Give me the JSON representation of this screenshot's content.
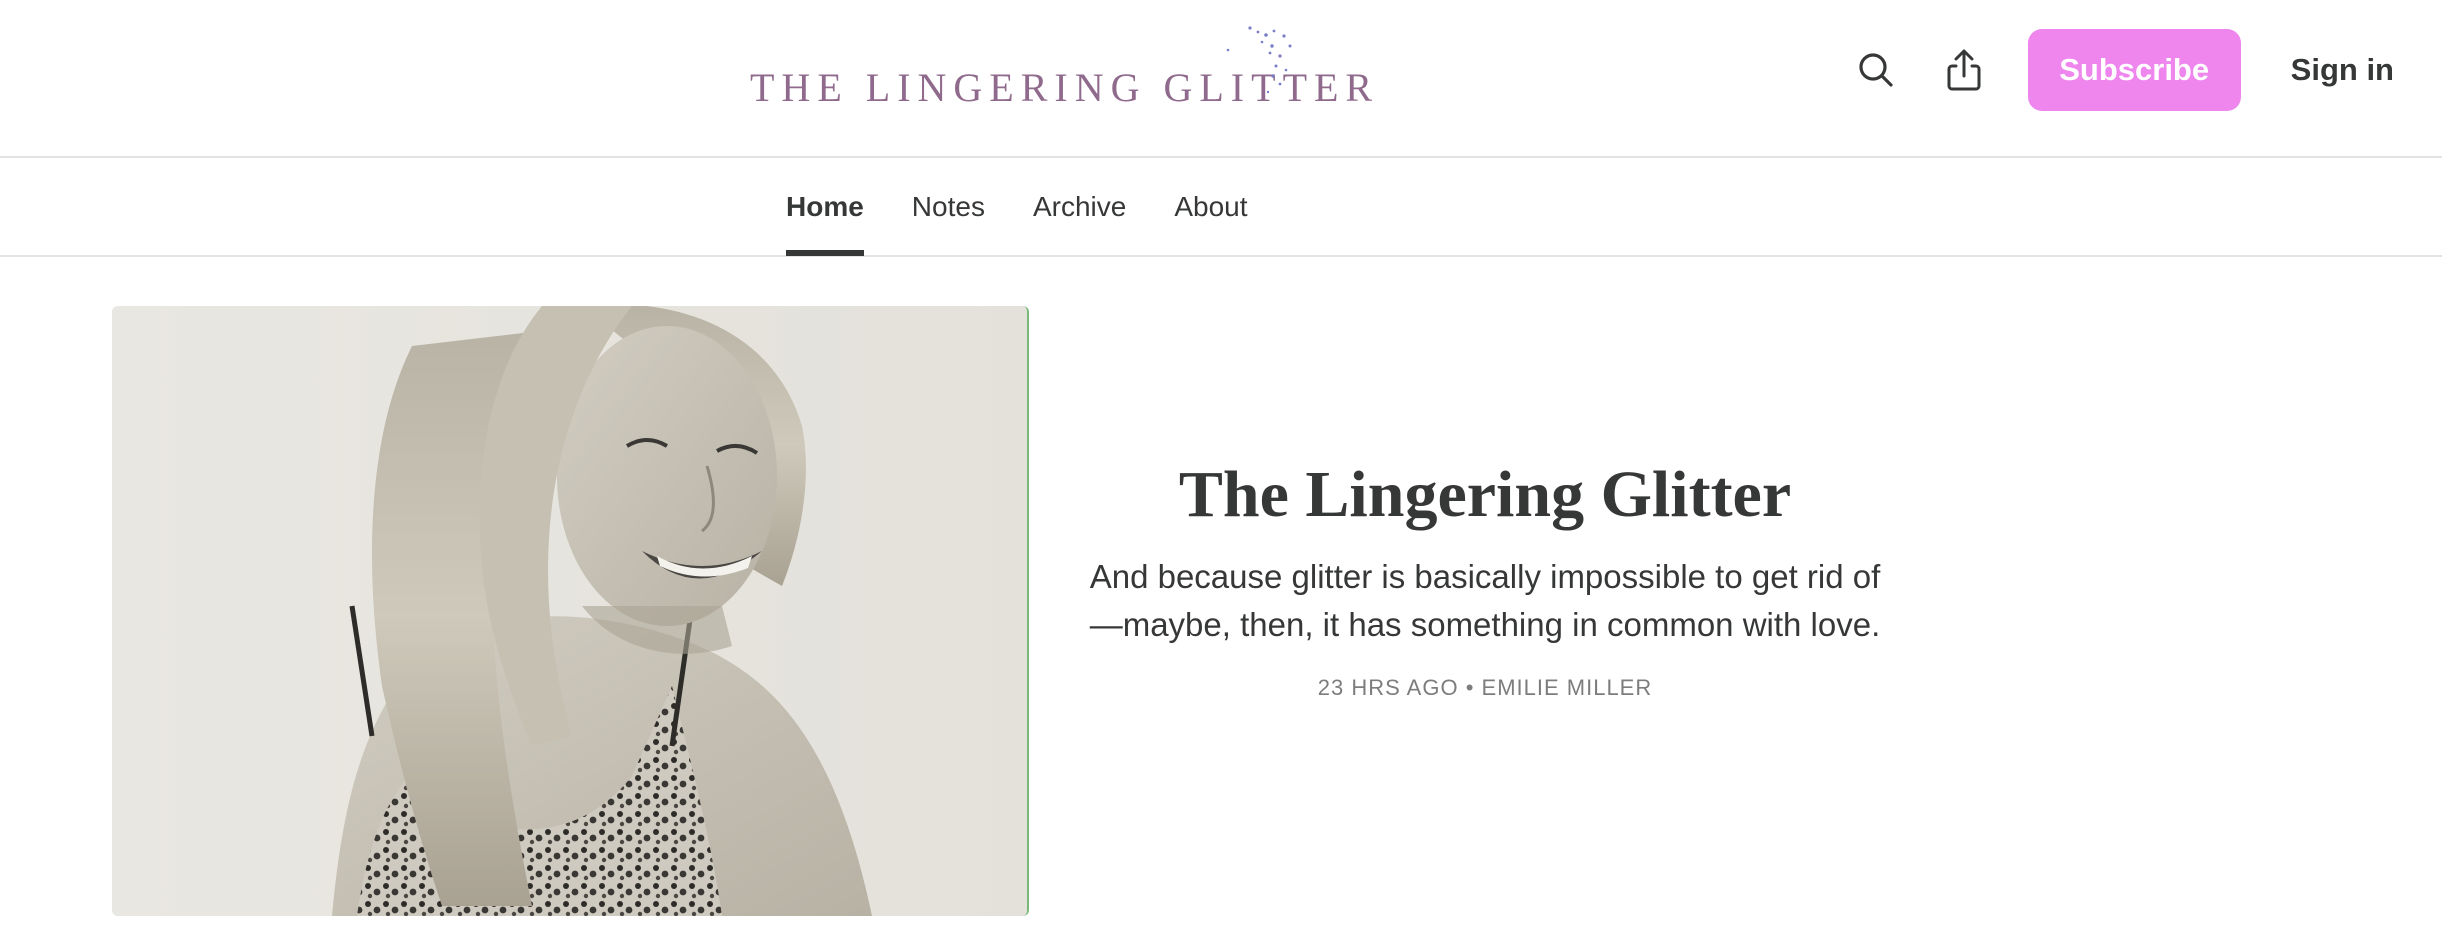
{
  "header": {
    "logo_text": "THE LINGERING GLITTER",
    "search_label": "Search",
    "share_label": "Share",
    "subscribe_label": "Subscribe",
    "signin_label": "Sign in"
  },
  "nav": {
    "tabs": [
      {
        "label": "Home",
        "active": true
      },
      {
        "label": "Notes",
        "active": false
      },
      {
        "label": "Archive",
        "active": false
      },
      {
        "label": "About",
        "active": false
      }
    ]
  },
  "featured_post": {
    "title": "The Lingering Glitter",
    "subtitle": "And because glitter is basically impossible to get rid of—maybe, then, it has something in common with love.",
    "time_ago": "23 HRS AGO",
    "separator": "•",
    "author": "EMILIE MILLER"
  },
  "colors": {
    "accent": "#ee86ee",
    "logo": "#8f6a8c",
    "glitter": "#7a7ec9",
    "text": "#363737",
    "meta": "#7d7d7d"
  },
  "icons": {
    "search": "search-icon",
    "share": "share-icon"
  }
}
